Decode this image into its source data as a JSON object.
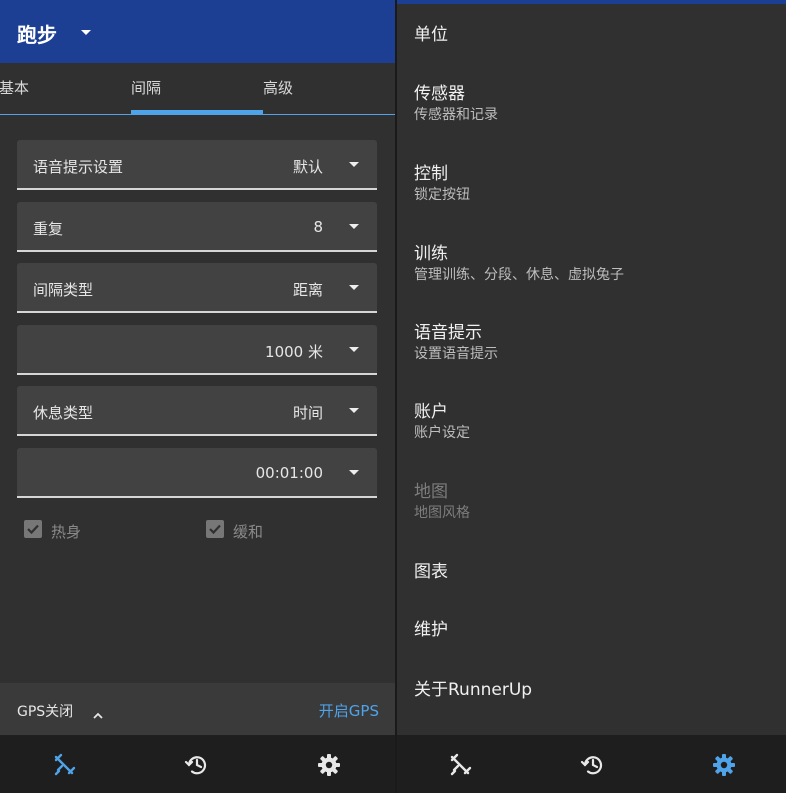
{
  "left": {
    "appbar": {
      "title": "跑步"
    },
    "tabs": [
      {
        "label": "基本",
        "selected": false
      },
      {
        "label": "间隔",
        "selected": true
      },
      {
        "label": "高级",
        "selected": false
      }
    ],
    "fields": [
      {
        "label": "语音提示设置",
        "value": "默认"
      },
      {
        "label": "重复",
        "value": "8"
      },
      {
        "label": "间隔类型",
        "value": "距离"
      },
      {
        "label": "",
        "value": "1000 米"
      },
      {
        "label": "休息类型",
        "value": "时间"
      },
      {
        "label": "",
        "value": "00:01:00"
      }
    ],
    "checks": [
      {
        "label": "热身",
        "checked": true
      },
      {
        "label": "缓和",
        "checked": true
      }
    ],
    "gps": {
      "status": "GPS关闭",
      "enable_label": "开启GPS"
    },
    "bottom_nav": [
      "workout-icon",
      "history-icon",
      "settings-icon"
    ],
    "bottom_nav_active": "workout-icon"
  },
  "right": {
    "items": [
      {
        "title": "单位",
        "subtitle": "",
        "enabled": true
      },
      {
        "title": "传感器",
        "subtitle": "传感器和记录",
        "enabled": true
      },
      {
        "title": "控制",
        "subtitle": "锁定按钮",
        "enabled": true
      },
      {
        "title": "训练",
        "subtitle": "管理训练、分段、休息、虚拟兔子",
        "enabled": true
      },
      {
        "title": "语音提示",
        "subtitle": "设置语音提示",
        "enabled": true
      },
      {
        "title": "账户",
        "subtitle": "账户设定",
        "enabled": true
      },
      {
        "title": "地图",
        "subtitle": "地图风格",
        "enabled": false
      },
      {
        "title": "图表",
        "subtitle": "",
        "enabled": true
      },
      {
        "title": "维护",
        "subtitle": "",
        "enabled": true
      },
      {
        "title": "关于RunnerUp",
        "subtitle": "",
        "enabled": true
      }
    ],
    "bottom_nav": [
      "workout-icon",
      "history-icon",
      "settings-icon"
    ],
    "bottom_nav_active": "settings-icon"
  },
  "colors": {
    "accent": "#4fa3e8",
    "appbar": "#1c3f94",
    "surface": "#303030",
    "field": "#424242",
    "nav": "#1e1e1e"
  }
}
